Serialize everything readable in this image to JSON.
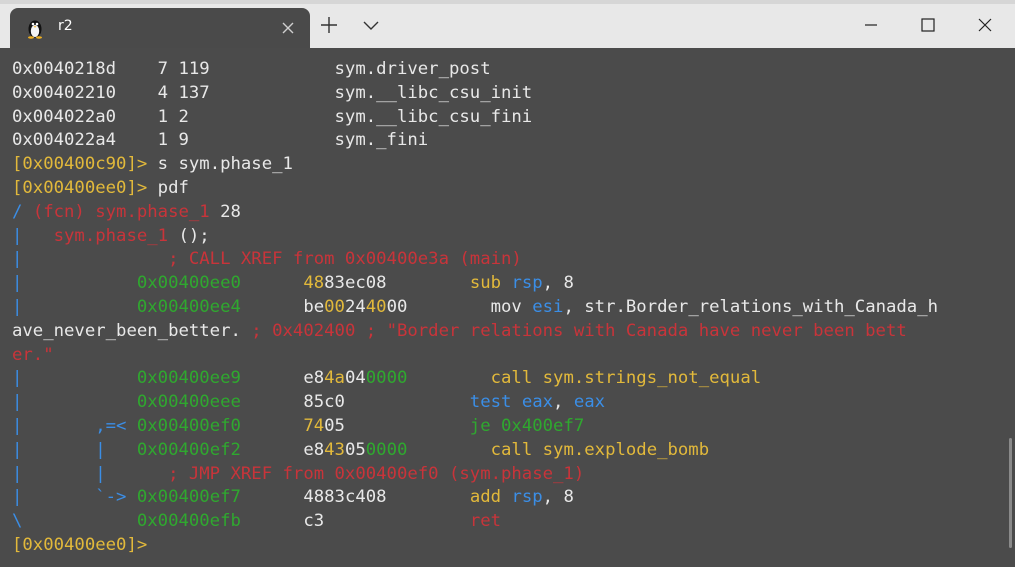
{
  "window": {
    "tab_title": "r2",
    "tab_icon": "linux-penguin-icon"
  },
  "terminal": {
    "lines": [
      [
        {
          "t": "0x0040218d    7 119            sym.driver_post",
          "c": "white"
        }
      ],
      [
        {
          "t": "0x00402210    4 137            sym.__libc_csu_init",
          "c": "white"
        }
      ],
      [
        {
          "t": "0x004022a0    1 2              sym.__libc_csu_fini",
          "c": "white"
        }
      ],
      [
        {
          "t": "0x004022a4    1 9              sym._fini",
          "c": "white"
        }
      ],
      [
        {
          "t": "[0x00400c90]>",
          "c": "yellow"
        },
        {
          "t": " s sym.phase_1",
          "c": "white"
        }
      ],
      [
        {
          "t": "[0x00400ee0]>",
          "c": "yellow"
        },
        {
          "t": " pdf",
          "c": "white"
        }
      ],
      [
        {
          "t": "/ ",
          "c": "blue"
        },
        {
          "t": "(fcn) sym.phase_1",
          "c": "red"
        },
        {
          "t": " 28",
          "c": "white"
        }
      ],
      [
        {
          "t": "|   ",
          "c": "blue"
        },
        {
          "t": "sym.phase_1",
          "c": "red"
        },
        {
          "t": " ();",
          "c": "white"
        }
      ],
      [
        {
          "t": "|",
          "c": "blue"
        },
        {
          "t": "              ; CALL XREF from 0x00400e3a (main)",
          "c": "red"
        }
      ],
      [
        {
          "t": "|",
          "c": "blue"
        },
        {
          "t": "           0x00400ee0      ",
          "c": "green"
        },
        {
          "t": "48",
          "c": "yellow"
        },
        {
          "t": "83ec08        ",
          "c": "white"
        },
        {
          "t": "sub",
          "c": "yellow"
        },
        {
          "t": " ",
          "c": "white"
        },
        {
          "t": "rsp",
          "c": "blue"
        },
        {
          "t": ", 8",
          "c": "white"
        }
      ],
      [
        {
          "t": "|",
          "c": "blue"
        },
        {
          "t": "           0x00400ee4      ",
          "c": "green"
        },
        {
          "t": "be",
          "c": "white"
        },
        {
          "t": "00",
          "c": "yellow"
        },
        {
          "t": "24",
          "c": "white"
        },
        {
          "t": "40",
          "c": "yellow"
        },
        {
          "t": "00",
          "c": "white"
        },
        {
          "t": "        mov ",
          "c": "white"
        },
        {
          "t": "esi",
          "c": "blue"
        },
        {
          "t": ", str.Border_relations_with_Canada_h",
          "c": "white"
        }
      ],
      [
        {
          "t": "ave_never_been_better.",
          "c": "white"
        },
        {
          "t": " ; 0x402400 ; \"Border relations with Canada have never been bett",
          "c": "red"
        }
      ],
      [
        {
          "t": "er.\"",
          "c": "red"
        }
      ],
      [
        {
          "t": "|",
          "c": "blue"
        },
        {
          "t": "           0x00400ee9      ",
          "c": "green"
        },
        {
          "t": "e8",
          "c": "white"
        },
        {
          "t": "4a",
          "c": "yellow"
        },
        {
          "t": "04",
          "c": "white"
        },
        {
          "t": "0000        ",
          "c": "green"
        },
        {
          "t": "call sym.strings_not_equal",
          "c": "yellow"
        }
      ],
      [
        {
          "t": "|",
          "c": "blue"
        },
        {
          "t": "           0x00400eee      ",
          "c": "green"
        },
        {
          "t": "85c0",
          "c": "white"
        },
        {
          "t": "            test ",
          "c": "blue"
        },
        {
          "t": "eax",
          "c": "blue"
        },
        {
          "t": ", ",
          "c": "white"
        },
        {
          "t": "eax",
          "c": "blue"
        }
      ],
      [
        {
          "t": "|       ,=< ",
          "c": "blue"
        },
        {
          "t": "0x00400ef0      ",
          "c": "green"
        },
        {
          "t": "74",
          "c": "yellow"
        },
        {
          "t": "05",
          "c": "white"
        },
        {
          "t": "            je 0x400ef7",
          "c": "green"
        }
      ],
      [
        {
          "t": "|       |   ",
          "c": "blue"
        },
        {
          "t": "0x00400ef2      ",
          "c": "green"
        },
        {
          "t": "e8",
          "c": "white"
        },
        {
          "t": "43",
          "c": "yellow"
        },
        {
          "t": "05",
          "c": "white"
        },
        {
          "t": "0000        ",
          "c": "green"
        },
        {
          "t": "call sym.explode_bomb",
          "c": "yellow"
        }
      ],
      [
        {
          "t": "|       |",
          "c": "blue"
        },
        {
          "t": "      ; JMP XREF from 0x00400ef0 (sym.phase_1)",
          "c": "red"
        }
      ],
      [
        {
          "t": "|       `-> ",
          "c": "blue"
        },
        {
          "t": "0x00400ef7      ",
          "c": "green"
        },
        {
          "t": "48",
          "c": "white"
        },
        {
          "t": "83c408        ",
          "c": "white"
        },
        {
          "t": "add",
          "c": "yellow"
        },
        {
          "t": " ",
          "c": "white"
        },
        {
          "t": "rsp",
          "c": "blue"
        },
        {
          "t": ", 8",
          "c": "white"
        }
      ],
      [
        {
          "t": "\\",
          "c": "blue"
        },
        {
          "t": "           0x00400efb      ",
          "c": "green"
        },
        {
          "t": "c3",
          "c": "white"
        },
        {
          "t": "              ",
          "c": "white"
        },
        {
          "t": "ret",
          "c": "red"
        }
      ],
      [
        {
          "t": "[0x00400ee0]>",
          "c": "yellow"
        }
      ]
    ]
  }
}
